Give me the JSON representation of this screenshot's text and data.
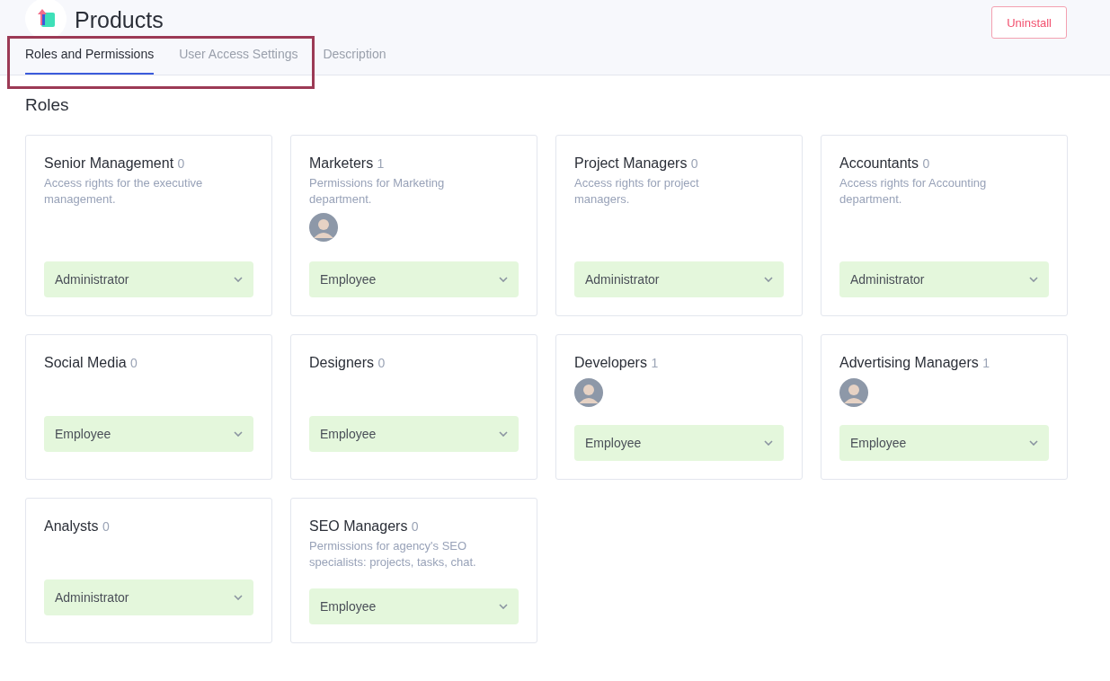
{
  "header": {
    "title": "Products",
    "action": "Uninstall"
  },
  "tabs": [
    {
      "label": "Roles and Permissions",
      "selected": true
    },
    {
      "label": "User Access Settings",
      "selected": false
    },
    {
      "label": "Description",
      "selected": false
    }
  ],
  "section_title": "Roles",
  "roles": [
    {
      "name": "Senior Management",
      "count": "0",
      "description": "Access rights for the executive management.",
      "member_photo": false,
      "access": "Administrator"
    },
    {
      "name": "Marketers",
      "count": "1",
      "description": "Permissions for Marketing department.",
      "member_photo": true,
      "access": "Employee"
    },
    {
      "name": "Project Managers",
      "count": "0",
      "description": "Access rights for project managers.",
      "member_photo": false,
      "access": "Administrator"
    },
    {
      "name": "Accountants",
      "count": "0",
      "description": "Access rights for Accounting department.",
      "member_photo": false,
      "access": "Administrator"
    },
    {
      "name": "Social Media",
      "count": "0",
      "member_photo": false,
      "access": "Employee"
    },
    {
      "name": "Designers",
      "count": "0",
      "member_photo": false,
      "access": "Employee"
    },
    {
      "name": "Developers",
      "count": "1",
      "member_photo": true,
      "access": "Employee"
    },
    {
      "name": "Advertising Managers",
      "count": "1",
      "member_photo": true,
      "access": "Employee"
    },
    {
      "name": "Analysts",
      "count": "0",
      "member_photo": false,
      "access": "Administrator"
    },
    {
      "name": "SEO Managers",
      "count": "0",
      "description": "Permissions for agency's SEO specialists: projects, tasks, chat.",
      "member_photo": false,
      "access": "Employee"
    }
  ]
}
